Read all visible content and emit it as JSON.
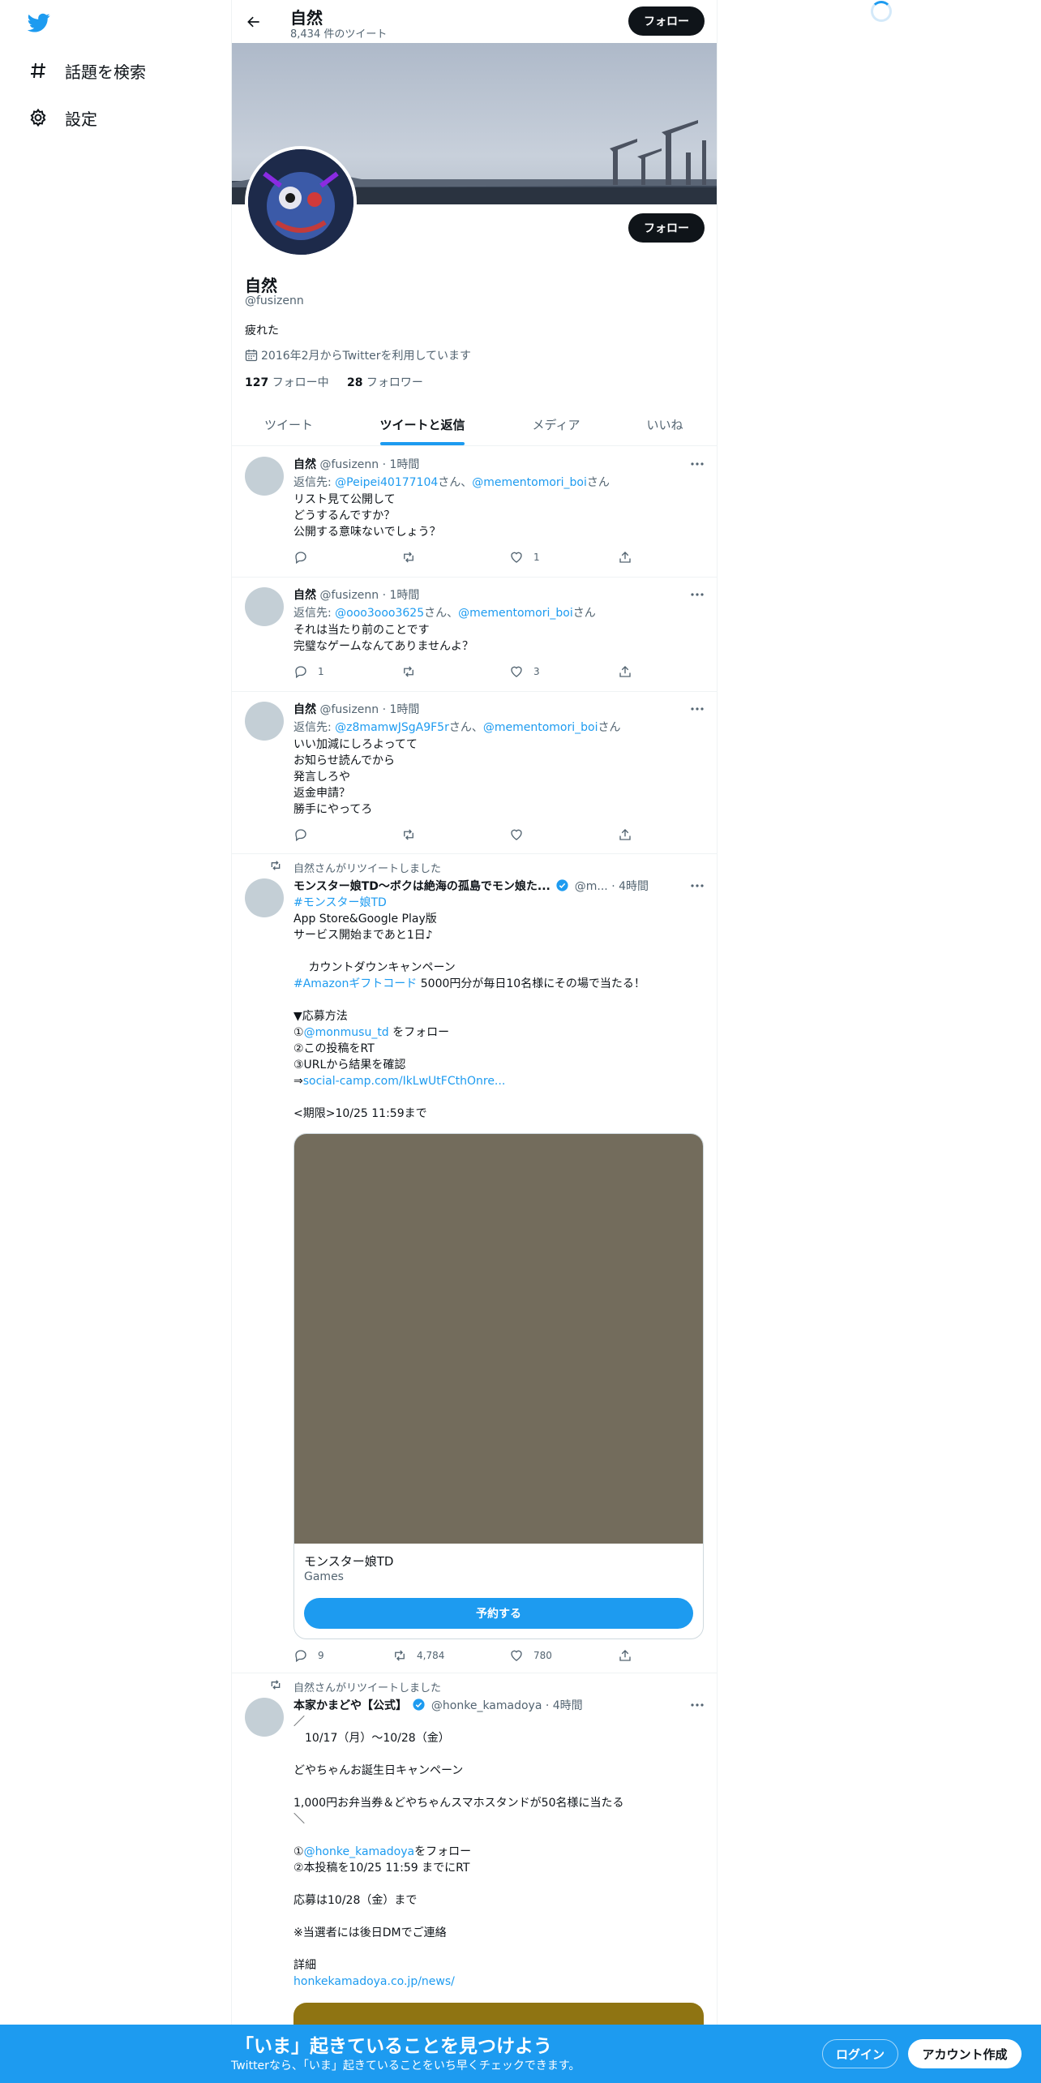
{
  "nav": {
    "explore_label": "話題を検索",
    "settings_label": "設定"
  },
  "header": {
    "name": "自然",
    "tweet_count": "8,434 件のツイート",
    "follow_label": "フォロー"
  },
  "profile": {
    "name": "自然",
    "handle": "@fusizenn",
    "bio": "疲れた",
    "joined": "2016年2月からTwitterを利用しています",
    "following_count": "127",
    "following_label": "フォロー中",
    "followers_count": "28",
    "followers_label": "フォロワー",
    "follow_label": "フォロー"
  },
  "tabs": [
    {
      "label": "ツイート"
    },
    {
      "label": "ツイートと返信"
    },
    {
      "label": "メディア"
    },
    {
      "label": "いいね"
    }
  ],
  "tweets": [
    {
      "name": "自然",
      "handle": "@fusizenn",
      "time": "· 1時間",
      "reply_prefix": "返信先: ",
      "reply_user1": "@Peipei40177104",
      "reply_mid": "さん、",
      "reply_user2": "@mementomori_boi",
      "reply_suffix": "さん",
      "text": "リスト見て公開して\nどうするんですか？\n公開する意味ないでしょう？",
      "replies": "",
      "retweets": "",
      "likes": "1"
    },
    {
      "name": "自然",
      "handle": "@fusizenn",
      "time": "· 1時間",
      "reply_prefix": "返信先: ",
      "reply_user1": "@ooo3ooo3625",
      "reply_mid": "さん、",
      "reply_user2": "@mementomori_boi",
      "reply_suffix": "さん",
      "text": "それは当たり前のことです\n完璧なゲームなんてありませんよ？",
      "replies": "1",
      "retweets": "",
      "likes": "3"
    },
    {
      "name": "自然",
      "handle": "@fusizenn",
      "time": "· 1時間",
      "reply_prefix": "返信先: ",
      "reply_user1": "@z8mamwJSgA9F5r",
      "reply_mid": "さん、",
      "reply_user2": "@mementomori_boi",
      "reply_suffix": "さん",
      "text": "いい加減にしろよってて\nお知らせ読んでから\n発言しろや\n返金申請？\n勝手にやってろ",
      "replies": "",
      "retweets": "",
      "likes": ""
    },
    {
      "retweeted_by": "自然さんがリツイートしました",
      "name": "モンスター娘TD～ボクは絶海の孤島でモン娘た...",
      "handle": "@m...",
      "time": "· 4時間",
      "hashtag": "#モンスター娘TD",
      "text1": "App Store&Google Play版\nサービス開始まであと1日♪\n\n　 カウントダウンキャンペーン",
      "hashtag2": "#Amazonギフトコード",
      "text2": " 5000円分が毎日10名様にその場で当たる！",
      "text3": "\n▼応募方法",
      "mention_prefix": "①",
      "mention": "@monmusu_td",
      "mention_suffix": " をフォロー",
      "text4": "②この投稿をRT\n③URLから結果を確認",
      "link_prefix": "⇒",
      "link": "social-camp.com/IkLwUtFCthOnre...",
      "text5": "<期限>10/25 11:59まで",
      "card_title": "モンスター娘TD",
      "card_sub": "Games",
      "card_button": "予約する",
      "replies": "9",
      "retweets": "4,784",
      "likes": "780"
    },
    {
      "retweeted_by": "自然さんがリツイートしました",
      "name": "本家かまどや【公式】",
      "handle": "@honke_kamadoya",
      "time": "· 4時間",
      "text1": "／\n　10/17（月）～10/28（金）\n\nどやちゃんお誕生日キャンペーン\n\n1,000円お弁当券＆どやちゃんスマホスタンドが50名様に当たる\n＼\n",
      "mention_prefix": "①",
      "mention": "@honke_kamadoya",
      "mention_suffix": "をフォロー",
      "text2": "②本投稿を10/25 11:59 までにRT\n\n応募は10/28（金）まで\n\n※当選者には後日DMでご連絡\n\n詳細",
      "link": "honkekamadoya.co.jp/news/"
    }
  ],
  "bottom_bar": {
    "title": "「いま」起きていることを見つけよう",
    "subtitle": "Twitterなら、「いま」起きていることをいち早くチェックできます。",
    "login_label": "ログイン",
    "signup_label": "アカウント作成"
  },
  "colors": {
    "accent": "#1d9bf0",
    "text": "#0f1419",
    "muted": "#536471"
  }
}
